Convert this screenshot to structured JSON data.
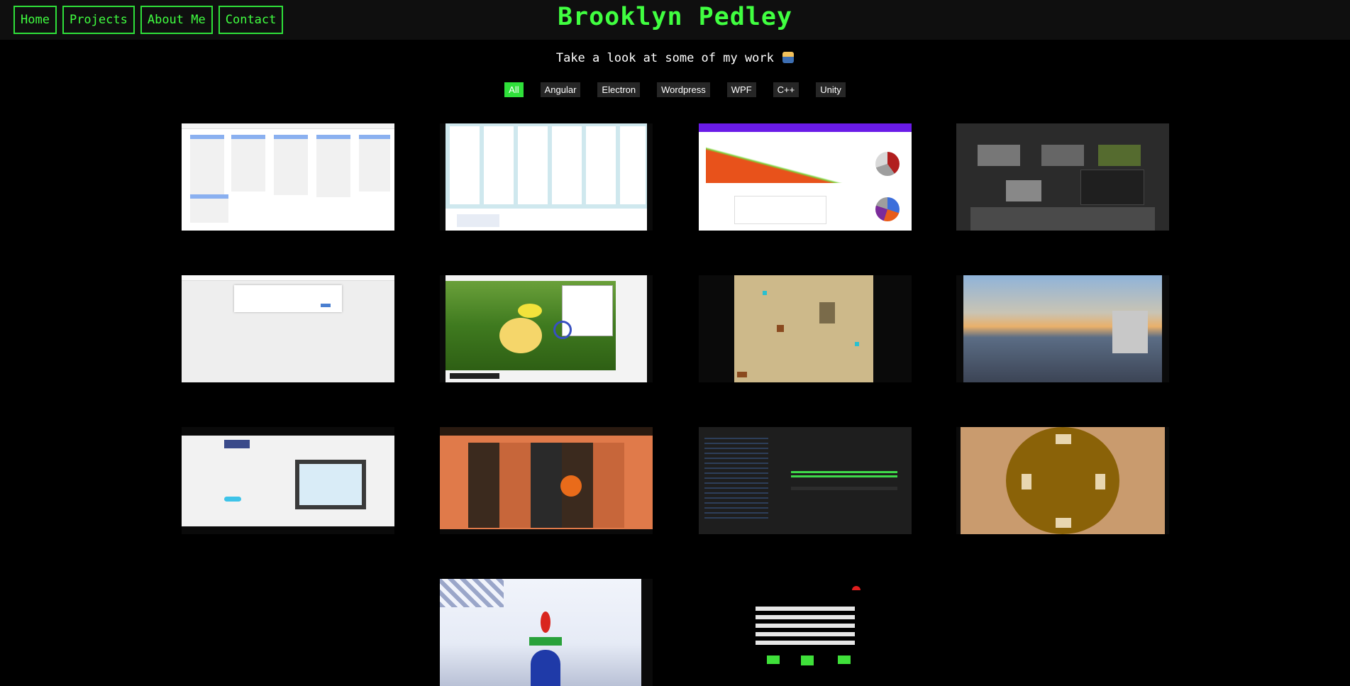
{
  "nav": {
    "items": [
      "Home",
      "Projects",
      "About Me",
      "Contact"
    ]
  },
  "site": {
    "title": "Brooklyn Pedley"
  },
  "tagline": "Take a look at some of my work",
  "filters": {
    "items": [
      "All",
      "Angular",
      "Electron",
      "Wordpress",
      "WPF",
      "C++",
      "Unity"
    ],
    "active": "All"
  },
  "colors": {
    "accent": "#2fe03a",
    "background": "#000000",
    "topbar": "#0f0f0f"
  },
  "projects": {
    "count": 14
  }
}
